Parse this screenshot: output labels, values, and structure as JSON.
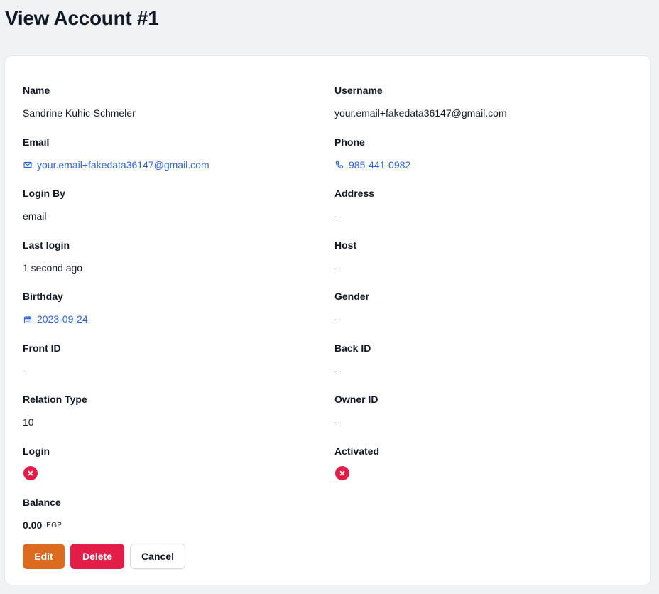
{
  "page": {
    "title": "View Account #1"
  },
  "fields": {
    "name": {
      "label": "Name",
      "value": "Sandrine Kuhic-Schmeler"
    },
    "username": {
      "label": "Username",
      "value": "your.email+fakedata36147@gmail.com"
    },
    "email": {
      "label": "Email",
      "value": "your.email+fakedata36147@gmail.com",
      "icon": "mail-icon"
    },
    "phone": {
      "label": "Phone",
      "value": "985-441-0982",
      "icon": "phone-icon"
    },
    "login_by": {
      "label": "Login By",
      "value": "email"
    },
    "address": {
      "label": "Address",
      "value": "-"
    },
    "last_login": {
      "label": "Last login",
      "value": "1 second ago"
    },
    "host": {
      "label": "Host",
      "value": "-"
    },
    "birthday": {
      "label": "Birthday",
      "value": "2023-09-24",
      "icon": "calendar-icon"
    },
    "gender": {
      "label": "Gender",
      "value": "-"
    },
    "front_id": {
      "label": "Front ID",
      "value": "-"
    },
    "back_id": {
      "label": "Back ID",
      "value": "-"
    },
    "relation_type": {
      "label": "Relation Type",
      "value": "10"
    },
    "owner_id": {
      "label": "Owner ID",
      "value": "-"
    },
    "login": {
      "label": "Login",
      "state": false,
      "icon": "x-circle-icon"
    },
    "activated": {
      "label": "Activated",
      "state": false,
      "icon": "x-circle-icon"
    },
    "balance": {
      "label": "Balance",
      "amount": "0.00",
      "currency": "EGP"
    }
  },
  "actions": {
    "edit_label": "Edit",
    "delete_label": "Delete",
    "cancel_label": "Cancel"
  },
  "colors": {
    "link": "#2d63d6",
    "edit": "#dc6a1f",
    "delete": "#e11d48",
    "false_badge": "#e11d48"
  }
}
